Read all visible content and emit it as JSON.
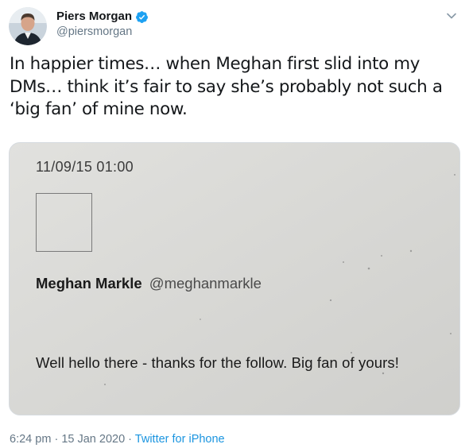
{
  "author": {
    "name": "Piers Morgan",
    "handle": "@piersmorgan",
    "verified": true,
    "avatar_icon": "profile-photo"
  },
  "tweet": {
    "text": "In happier times… when Meghan first slid into my DMs… think it’s fair to say she’s probably not such a ‘big fan’ of mine now."
  },
  "media": {
    "dm_date": "11/09/15 01:00",
    "sender_name": "Meghan Markle",
    "sender_handle": "@meghanmarkle",
    "message": "Well hello there - thanks for the follow. Big fan of yours!"
  },
  "meta": {
    "time": "6:24 pm",
    "separator": "·",
    "date": "15 Jan 2020",
    "source": "Twitter for iPhone"
  },
  "colors": {
    "name": "#14171a",
    "secondary": "#657786",
    "link": "#1b95e0",
    "verified": "#1da1f2",
    "media_bg": "#d9d9d6"
  }
}
